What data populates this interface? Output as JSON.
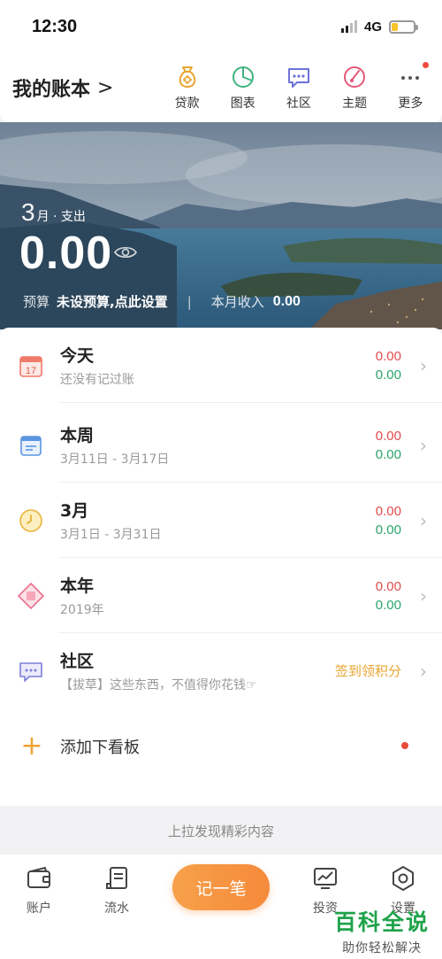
{
  "status_bar": {
    "time": "12:30",
    "network": "4G"
  },
  "header": {
    "book_title": "我的账本",
    "chevron": ">",
    "nav": [
      {
        "label": "贷款",
        "icon": "money-bag-icon"
      },
      {
        "label": "图表",
        "icon": "pie-chart-icon"
      },
      {
        "label": "社区",
        "icon": "chat-bubble-icon"
      },
      {
        "label": "主题",
        "icon": "palette-icon"
      },
      {
        "label": "更多",
        "icon": "more-dots-icon"
      }
    ]
  },
  "hero": {
    "month_num": "3",
    "month_suffix": "月 · 支出",
    "amount": "0.00",
    "budget_label": "预算",
    "budget_value": "未设预算,点此设置",
    "separator": "|",
    "income_label": "本月收入",
    "income_value": "0.00"
  },
  "rows": [
    {
      "title": "今天",
      "subtitle": "还没有记过账",
      "expense": "0.00",
      "income": "0.00"
    },
    {
      "title": "本周",
      "subtitle": "3月11日 - 3月17日",
      "expense": "0.00",
      "income": "0.00"
    },
    {
      "title": "3月",
      "subtitle": "3月1日 - 3月31日",
      "expense": "0.00",
      "income": "0.00"
    },
    {
      "title": "本年",
      "subtitle": "2019年",
      "expense": "0.00",
      "income": "0.00"
    }
  ],
  "community": {
    "title": "社区",
    "subtitle": "【拔草】这些东西，不值得你花钱☞",
    "action": "签到领积分"
  },
  "calendar_day": "17",
  "add_board": {
    "plus": "+",
    "label": "添加下看板"
  },
  "pull_hint": "上拉发现精彩内容",
  "tabs": {
    "account": "账户",
    "flow": "流水",
    "record": "记一笔",
    "invest": "投资",
    "settings": "设置"
  },
  "watermark": {
    "title": "百科全说",
    "subtitle": "助你轻松解决"
  },
  "colors": {
    "accent": "#f58a3b",
    "expense": "#e24b4b",
    "income": "#2aa56b",
    "checkin": "#e8a531"
  }
}
